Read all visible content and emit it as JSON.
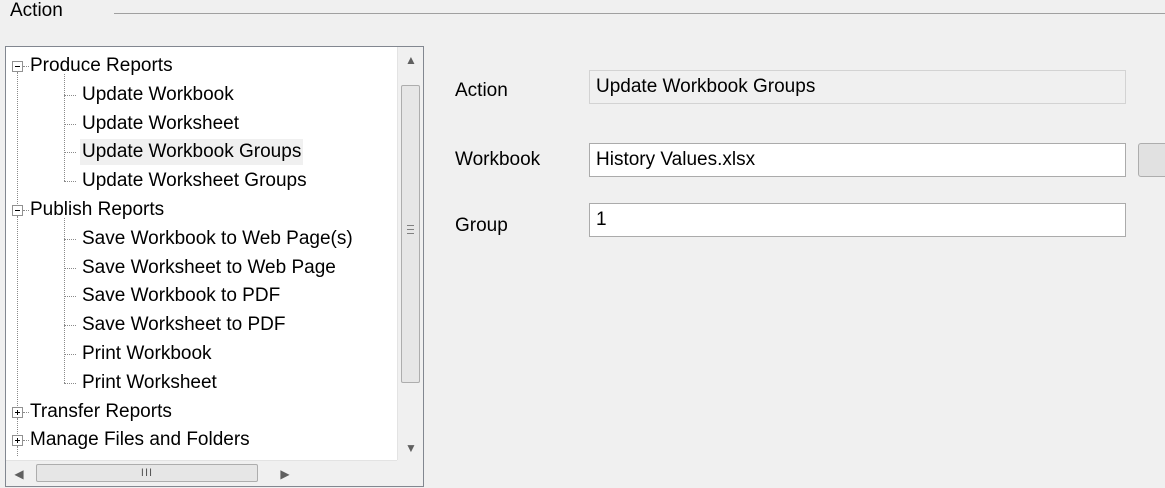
{
  "group": {
    "title": "Action"
  },
  "tree": {
    "nodes": [
      {
        "label": "Produce Reports",
        "expanded": true,
        "children": [
          {
            "label": "Update Workbook"
          },
          {
            "label": "Update Worksheet"
          },
          {
            "label": "Update Workbook Groups",
            "selected": true
          },
          {
            "label": "Update Worksheet Groups"
          }
        ]
      },
      {
        "label": "Publish Reports",
        "expanded": true,
        "children": [
          {
            "label": "Save Workbook to Web Page(s)"
          },
          {
            "label": "Save Worksheet to Web Page"
          },
          {
            "label": "Save Workbook to PDF"
          },
          {
            "label": "Save Worksheet to PDF"
          },
          {
            "label": "Print Workbook"
          },
          {
            "label": "Print Worksheet"
          }
        ]
      },
      {
        "label": "Transfer Reports",
        "expanded": false
      },
      {
        "label": "Manage Files and Folders",
        "expanded": false
      }
    ],
    "scrollbar_h_grip": "III"
  },
  "form": {
    "action": {
      "label": "Action",
      "value": "Update Workbook Groups"
    },
    "workbook": {
      "label": "Workbook",
      "value": "History Values.xlsx"
    },
    "group": {
      "label": "Group",
      "value": "1"
    }
  },
  "icons": {
    "collapse": "minus-box-icon",
    "expand": "plus-box-icon",
    "scroll_up": "▲",
    "scroll_down": "▼",
    "scroll_left": "◀",
    "scroll_right": "▶"
  }
}
